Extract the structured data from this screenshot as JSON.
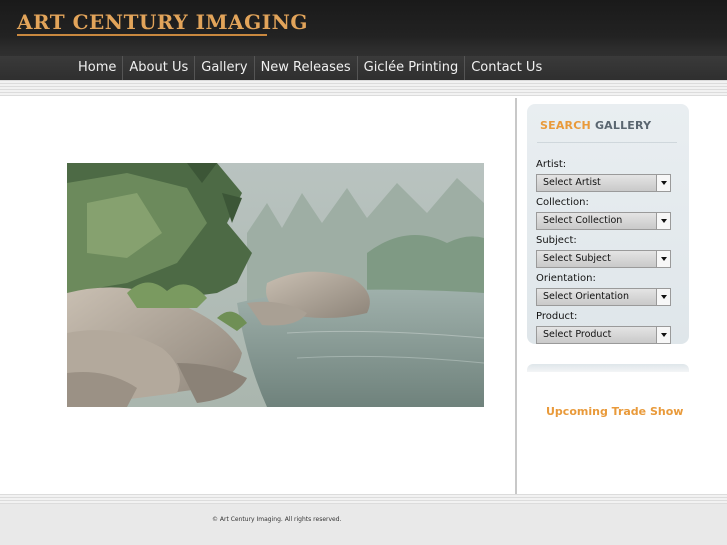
{
  "header": {
    "logo_text": "ART CENTURY IMAGING"
  },
  "nav": {
    "items": [
      "Home",
      "About Us",
      "Gallery",
      "New Releases",
      "Giclée Printing",
      "Contact Us"
    ]
  },
  "search": {
    "title_accent": "SEARCH",
    "title_rest": "GALLERY",
    "fields": [
      {
        "label": "Artist:",
        "value": "Select Artist"
      },
      {
        "label": "Collection:",
        "value": "Select Collection"
      },
      {
        "label": "Subject:",
        "value": "Select Subject"
      },
      {
        "label": "Orientation:",
        "value": "Select Orientation"
      },
      {
        "label": "Product:",
        "value": "Select Product"
      }
    ]
  },
  "sidebar": {
    "trade_show": "Upcoming Trade Show"
  },
  "footer": {
    "copyright": "© Art Century Imaging. All rights reserved."
  },
  "colors": {
    "accent": "#e99a3a",
    "header_bg": "#1a1a1a",
    "logo": "#e2a45a"
  }
}
